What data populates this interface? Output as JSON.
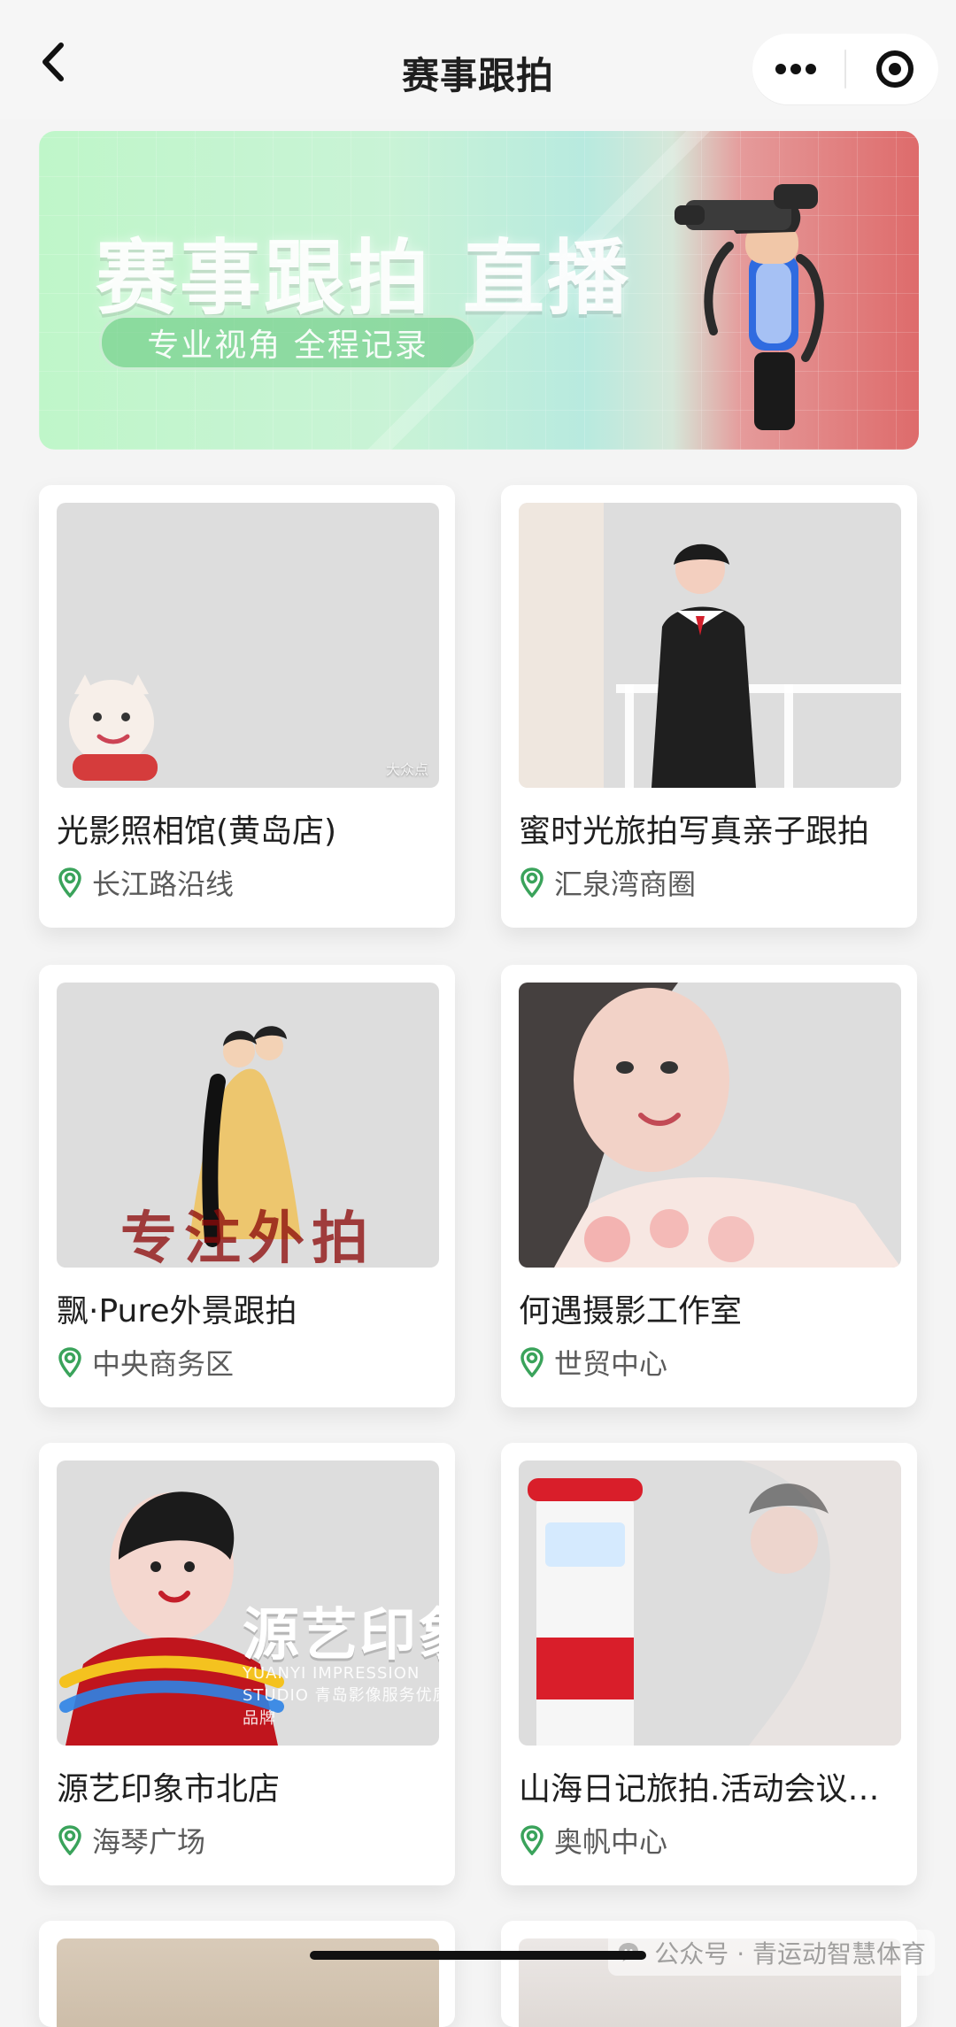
{
  "header": {
    "title": "赛事跟拍",
    "back_icon": "chevron-left-icon",
    "more_icon": "more-dots-icon",
    "target_icon": "target-icon"
  },
  "banner": {
    "title": "赛事跟拍 直播",
    "subtitle": "专业视角 全程记录"
  },
  "cards": [
    {
      "name": "光影照相馆(黄岛店)",
      "location": "长江路沿线",
      "image_style": "img-a",
      "thumb_tag": "大众点"
    },
    {
      "name": "蜜时光旅拍写真亲子跟拍",
      "location": "汇泉湾商圈",
      "image_style": "img-b",
      "thumb_tag": ""
    },
    {
      "name": "飘·Pure外景跟拍",
      "location": "中央商务区",
      "image_style": "img-c",
      "thumb_caption": "专注外拍"
    },
    {
      "name": "何遇摄影工作室",
      "location": "世贸中心",
      "image_style": "img-d",
      "thumb_tag": ""
    },
    {
      "name": "源艺印象市北店",
      "location": "海琴广场",
      "image_style": "img-e",
      "stamp_title": "源艺印象",
      "stamp_sub": "YUANYI IMPRESSION STUDIO\n青岛影像服务优质品牌"
    },
    {
      "name": "山海日记旅拍.活动会议…",
      "location": "奥帆中心",
      "image_style": "img-f",
      "thumb_tag": ""
    }
  ],
  "watermark": {
    "text": "公众号 · 青运动智慧体育",
    "icon": "wechat-icon"
  },
  "colors": {
    "pin_green": "#3aa35b"
  }
}
